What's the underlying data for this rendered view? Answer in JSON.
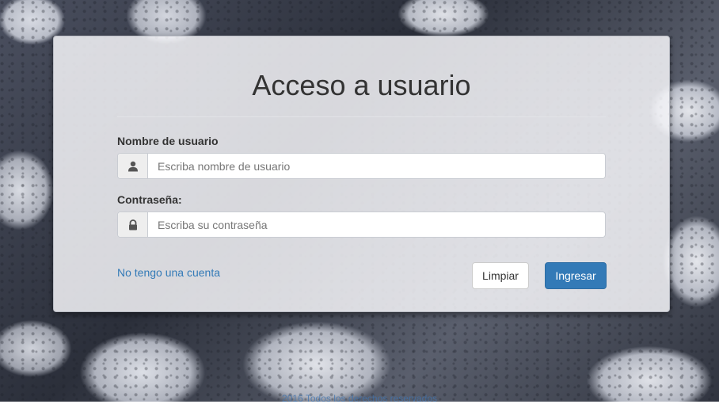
{
  "login": {
    "title": "Acceso a usuario",
    "username_label": "Nombre de usuario",
    "username_placeholder": "Escriba nombre de usuario",
    "username_value": "",
    "password_label": "Contraseña:",
    "password_placeholder": "Escriba su contraseña",
    "password_value": "",
    "no_account_link": "No tengo una cuenta",
    "clear_button": "Limpiar",
    "submit_button": "Ingresar"
  },
  "icons": {
    "username_addon": "user-icon",
    "password_addon": "lock-icon"
  },
  "footer": {
    "text": "2016 Todos los derechos reservados"
  },
  "colors": {
    "primary": "#337ab7",
    "link": "#337ab7"
  }
}
